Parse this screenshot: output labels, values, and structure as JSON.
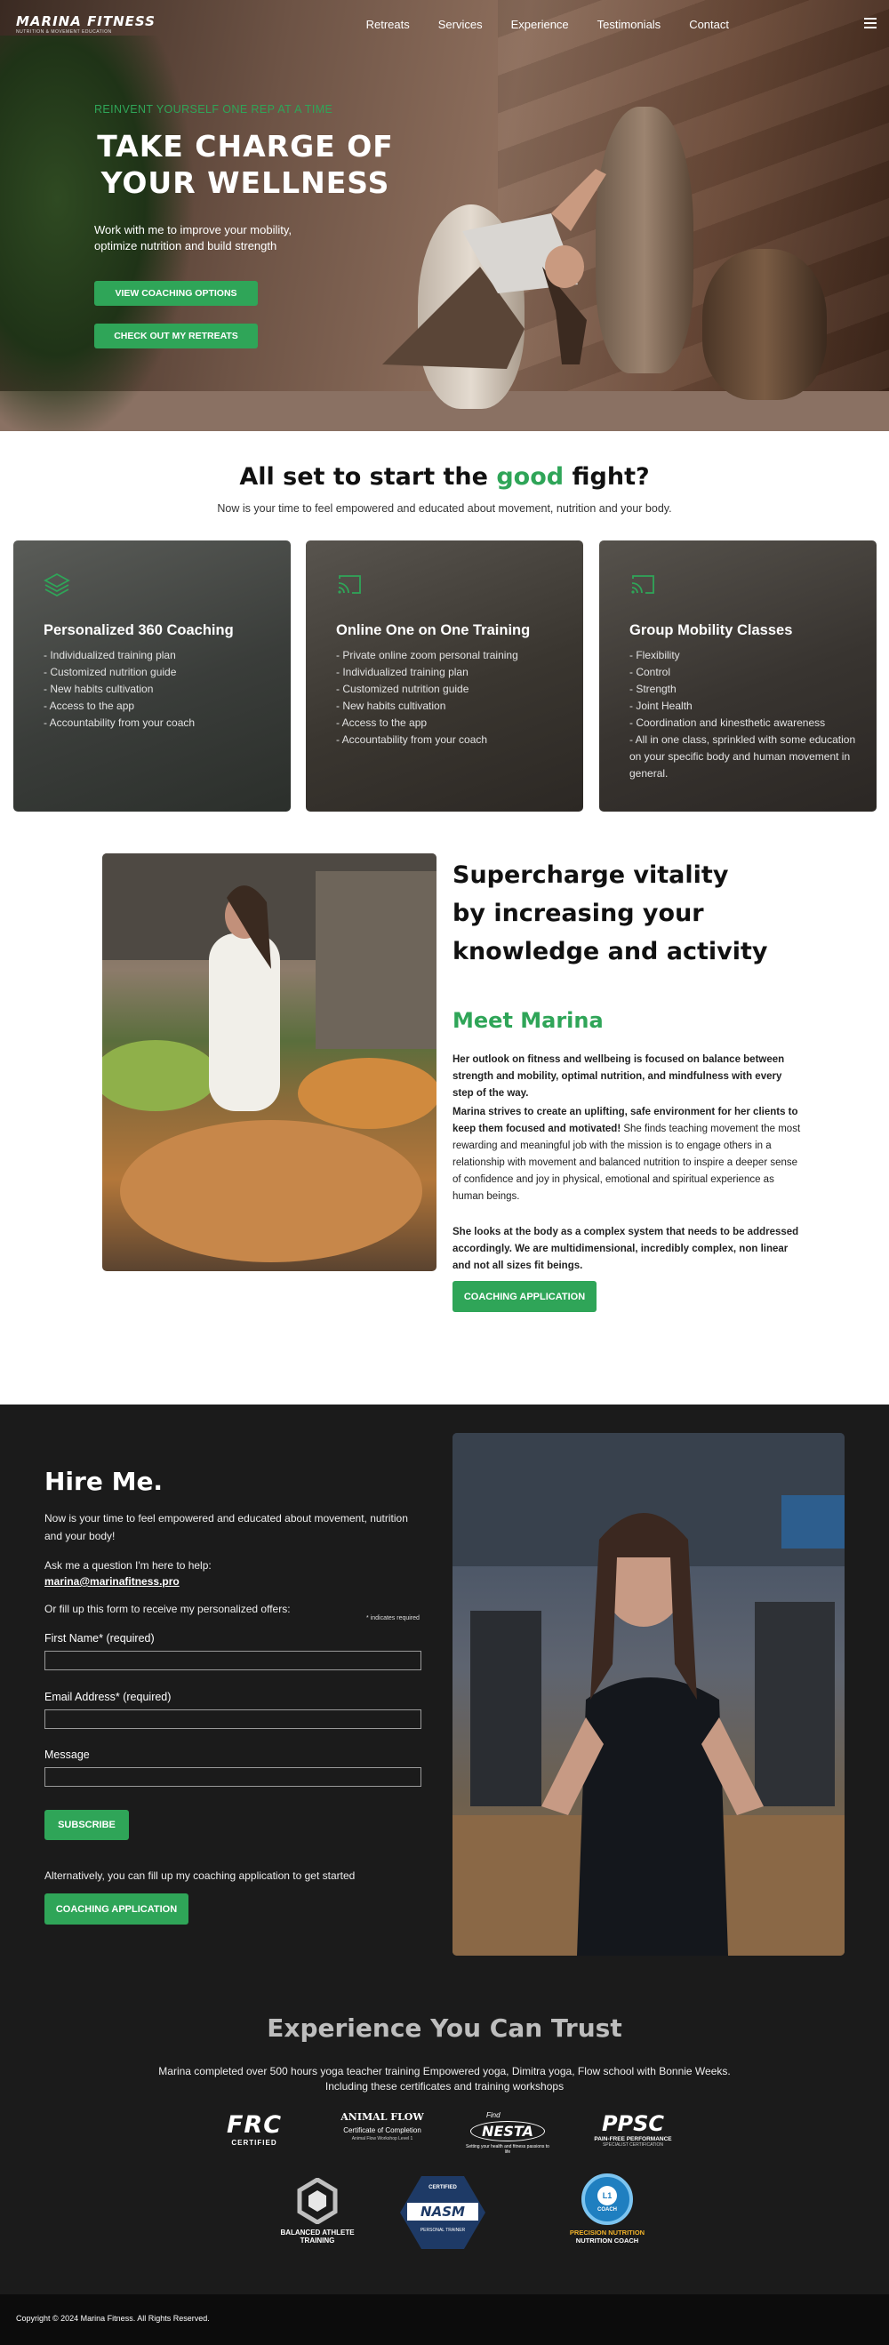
{
  "nav": {
    "logo_name": "MARINA FITNESS",
    "logo_tagline": "NUTRITION & MOVEMENT EDUCATION",
    "links": [
      "Retreats",
      "Services",
      "Experience",
      "Testimonials",
      "Contact"
    ],
    "menu_icon": "hamburger-icon"
  },
  "hero": {
    "eyebrow": "REINVENT YOURSELF ONE REP AT A TIME",
    "title_line1": "TAKE CHARGE OF",
    "title_line2": "YOUR WELLNESS",
    "subtitle": "Work with me to improve your mobility, optimize nutrition and build strength",
    "button1": "VIEW COACHING OPTIONS",
    "button2": "CHECK OUT MY RETREATS"
  },
  "services": {
    "title_pre": "All set to start the",
    "title_accent": "good",
    "title_post": "fight?",
    "lead": "Now is your time to feel empowered and educated about movement, nutrition and your body.",
    "cards": [
      {
        "icon": "layers-icon",
        "title": "Personalized 360 Coaching",
        "items": [
          "- Individualized training plan",
          "- Customized nutrition guide",
          "- New habits cultivation",
          "- Access to the app",
          "- Accountability from your coach"
        ]
      },
      {
        "icon": "cast-icon",
        "title": "Online One on One Training",
        "items": [
          "- Private online zoom personal training",
          "- Individualized training plan",
          "- Customized nutrition guide",
          "- New habits cultivation",
          "- Access to the app",
          "- Accountability from your coach"
        ]
      },
      {
        "icon": "cast-icon",
        "title": "Group Mobility Classes",
        "items": [
          "- Flexibility",
          "- Control",
          "- Strength",
          "- Joint Health",
          "- Coordination and kinesthetic awareness",
          "- All in one class, sprinkled with some education on your specific body and human movement in general."
        ]
      }
    ]
  },
  "about": {
    "title": "Supercharge vitality by increasing your knowledge and activity",
    "title_line1": "Supercharge vitality",
    "title_line2": "by increasing your",
    "title_line3": "knowledge and activity",
    "meet": "Meet Marina",
    "p1": "Her outlook on fitness and wellbeing is focused on balance between strength and mobility, optimal nutrition, and mindfulness with every step of the way.",
    "p2_bold": "Marina strives to create an uplifting, safe environment for her clients to keep them focused and motivated!",
    "p2_rest": " She finds teaching movement the most rewarding and meaningful job with the mission is to engage others in a relationship with movement and balanced nutrition to inspire a deeper sense of confidence and joy in physical, emotional and spiritual experience as human beings.",
    "p3": "She looks at the body as a complex system that needs to be addressed accordingly. We are multidimensional, incredibly complex, non linear and not all sizes fit beings.",
    "button": "COACHING APPLICATION"
  },
  "hire": {
    "title": "Hire Me.",
    "intro": "Now is your time to feel empowered and educated about movement, nutrition and your body!",
    "ask": "Ask me a question I'm here to help:",
    "email": "marina@marinafitness.pro",
    "or_fill": "Or fill up this form to receive my personalized offers:",
    "required_note": "* indicates required",
    "first_name_label": "First Name* (required)",
    "email_label": "Email Address* (required)",
    "message_label": "Message",
    "first_name_value": "",
    "email_value": "",
    "message_value": "",
    "subscribe": "SUBSCRIBE",
    "alt_text": "Alternatively, you can fill up my coaching application to get started",
    "coaching_button": "COACHING APPLICATION"
  },
  "trust": {
    "title": "Experience You Can Trust",
    "line1": "Marina completed over 500 hours yoga teacher training Empowered yoga, Dimitra yoga, Flow school with Bonnie Weeks.",
    "line2": "Including these certificates and training workshops",
    "badges": {
      "frc_main": "FRC",
      "frc_sub": "CERTIFIED",
      "animal_main": "ANIMAL FLOW",
      "animal_sub": "Certificate of Completion",
      "animal_small": "Animal Flow Workshop Level 1",
      "nesta_main": "NESTA",
      "nesta_top": "Find",
      "nesta_sub": "Setting your health and fitness passions to life",
      "ppsc_main": "PPSC",
      "ppsc_sub": "PAIN-FREE PERFORMANCE",
      "ppsc_small": "SPECIALIST CERTIFICATION",
      "bat_main": "BALANCED ATHLETE",
      "bat_sub": "TRAINING",
      "nasm_top": "CERTIFIED",
      "nasm_main": "NASM",
      "nasm_sub": "PERSONAL TRAINER",
      "pn_level": "L1",
      "pn_coach": "COACH",
      "pn_main": "PRECISION NUTRITION",
      "pn_sub": "NUTRITION COACH"
    }
  },
  "footer": {
    "copyright": "Copyright © 2024 Marina Fitness. All Rights Reserved."
  },
  "colors": {
    "accent": "#2fa558",
    "dark": "#1b1b1b",
    "footer": "#0c0c0c"
  }
}
